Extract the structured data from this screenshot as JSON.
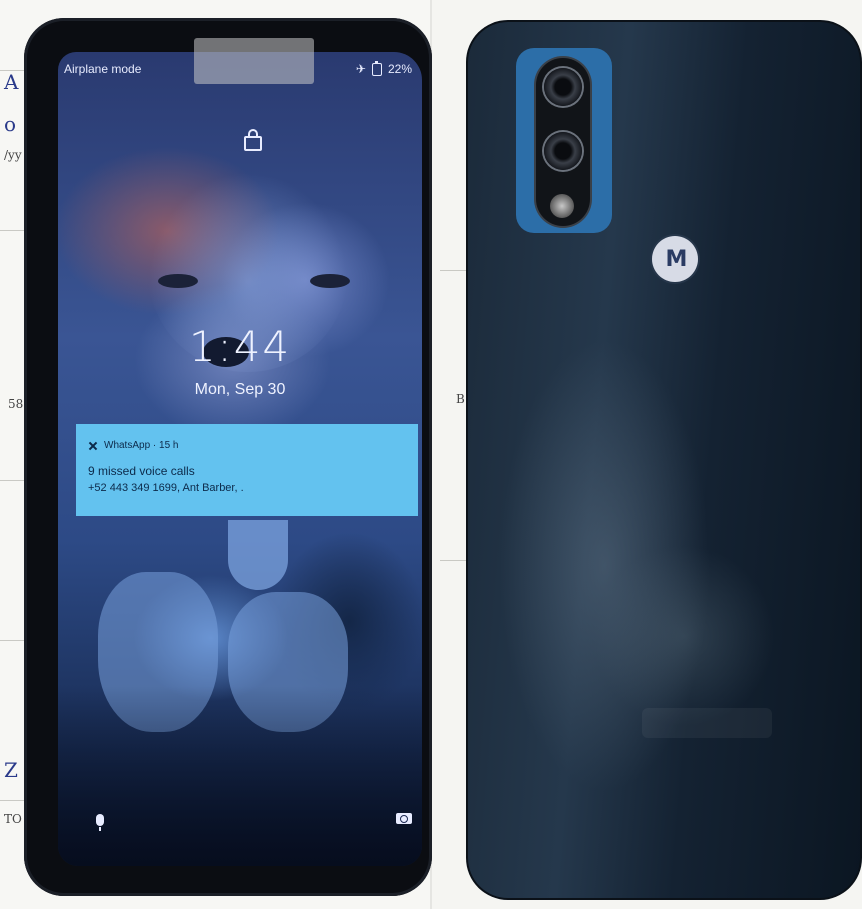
{
  "status_bar": {
    "mode": "Airplane mode",
    "battery": "22%",
    "airplane_symbol": "✈"
  },
  "lock_screen": {
    "time": "1:44",
    "date": "Mon, Sep 30"
  },
  "notification": {
    "app": "WhatsApp · 15 h",
    "title": "9 missed voice calls",
    "body": "+52 443 349 1699, Ant Barber, ."
  },
  "back": {
    "logo_glyph": "M"
  },
  "paper_notes": {
    "left_1": "A",
    "left_2": "o",
    "left_3": "/yy",
    "left_4": "58",
    "left_5": "Z",
    "left_6": "TO",
    "right_1": "B"
  },
  "icons": [
    "airplane-icon",
    "battery-icon",
    "lock-icon",
    "whatsapp-icon",
    "mic-icon",
    "camera-icon",
    "motorola-logo-icon"
  ],
  "colors": {
    "notification_bg": "#63c2ef",
    "camera_module": "#2c6ea8",
    "phone_back": "#1b2a3a"
  }
}
